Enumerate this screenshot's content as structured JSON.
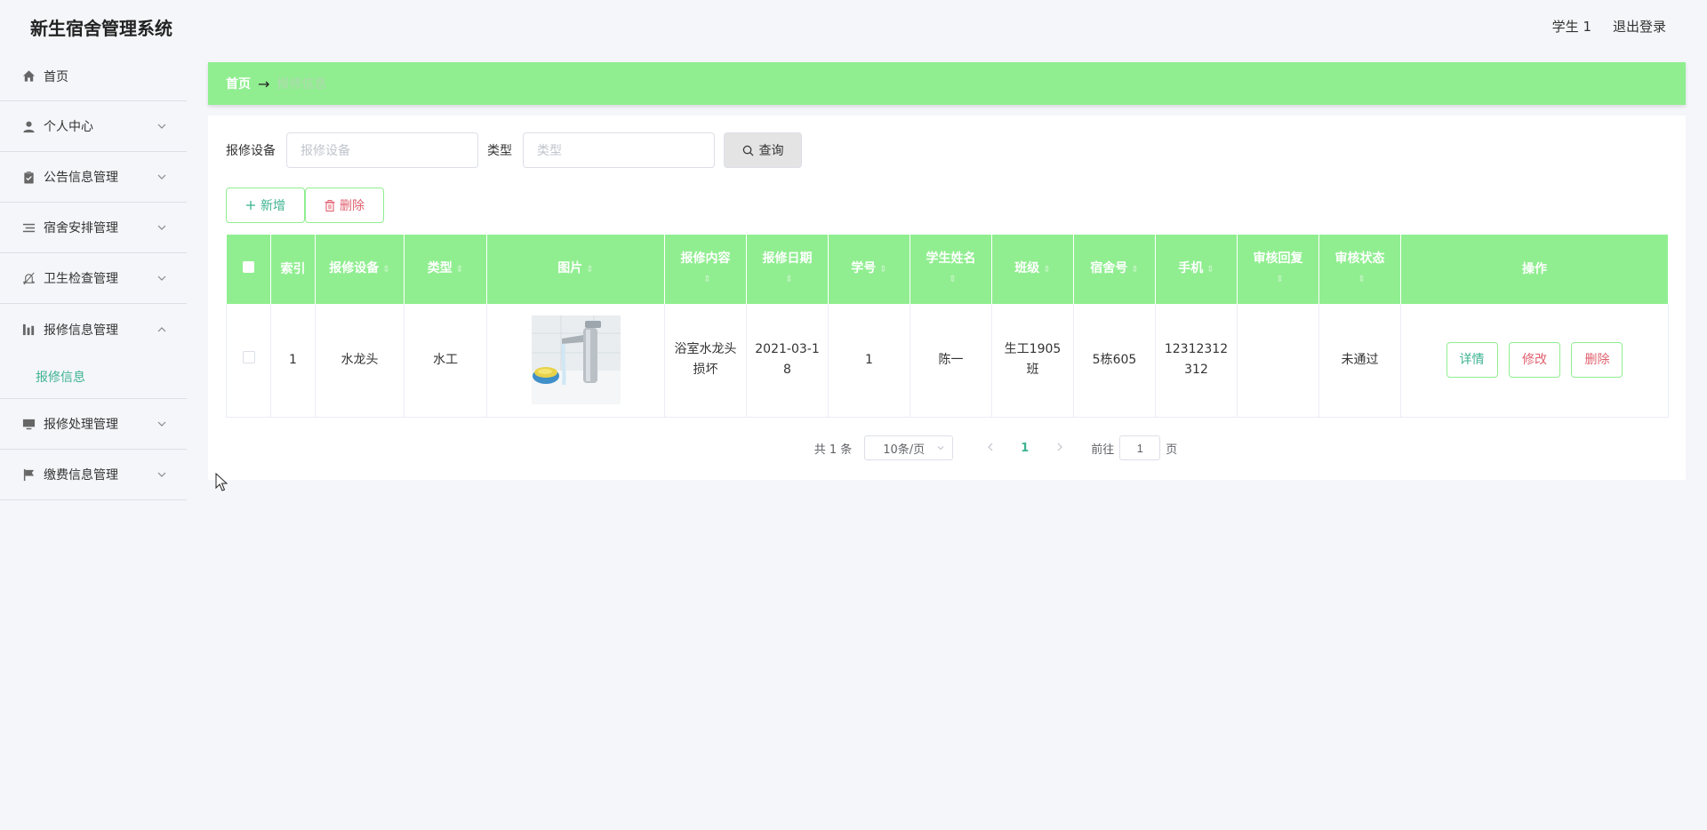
{
  "app": {
    "title": "新生宿舍管理系统",
    "user_label": "学生 1",
    "logout_label": "退出登录"
  },
  "sidebar": {
    "items": [
      {
        "label": "首页",
        "icon": "home-icon"
      },
      {
        "label": "个人中心",
        "icon": "user-icon"
      },
      {
        "label": "公告信息管理",
        "icon": "clipboard-icon"
      },
      {
        "label": "宿舍安排管理",
        "icon": "list-icon"
      },
      {
        "label": "卫生检查管理",
        "icon": "bell-off-icon"
      },
      {
        "label": "报修信息管理",
        "icon": "chart-icon",
        "expanded": true
      },
      {
        "label": "报修处理管理",
        "icon": "monitor-icon"
      },
      {
        "label": "缴费信息管理",
        "icon": "flag-icon"
      }
    ],
    "submenu": {
      "label": "报修信息",
      "active": true
    }
  },
  "breadcrumb": {
    "home": "首页",
    "separator": "→",
    "current": "报修信息"
  },
  "search": {
    "equipment_label": "报修设备",
    "equipment_placeholder": "报修设备",
    "type_label": "类型",
    "type_placeholder": "类型",
    "query_label": "查询"
  },
  "actions": {
    "add_label": "新增",
    "delete_label": "删除"
  },
  "table": {
    "columns": [
      "索引",
      "报修设备",
      "类型",
      "图片",
      "报修内容",
      "报修日期",
      "学号",
      "学生姓名",
      "班级",
      "宿舍号",
      "手机",
      "审核回复",
      "审核状态",
      "操作"
    ],
    "rows": [
      {
        "index": "1",
        "equipment": "水龙头",
        "type": "水工",
        "content": "浴室水龙头损坏",
        "date": "2021-03-18",
        "student_no": "1",
        "student_name": "陈一",
        "class": "生工1905班",
        "dorm": "5栋605",
        "phone": "12312312312",
        "review_reply": "",
        "review_status": "未通过",
        "ops": {
          "detail": "详情",
          "edit": "修改",
          "delete": "删除"
        }
      }
    ]
  },
  "pagination": {
    "total_text": "共 1 条",
    "page_size": "10条/页",
    "current_page": "1",
    "goto_prefix": "前往",
    "goto_value": "1",
    "goto_suffix": "页"
  },
  "colors": {
    "accent_green": "#90ee90",
    "text_teal": "#3eb391",
    "danger": "#e0606e",
    "background": "#f5f6fa"
  }
}
